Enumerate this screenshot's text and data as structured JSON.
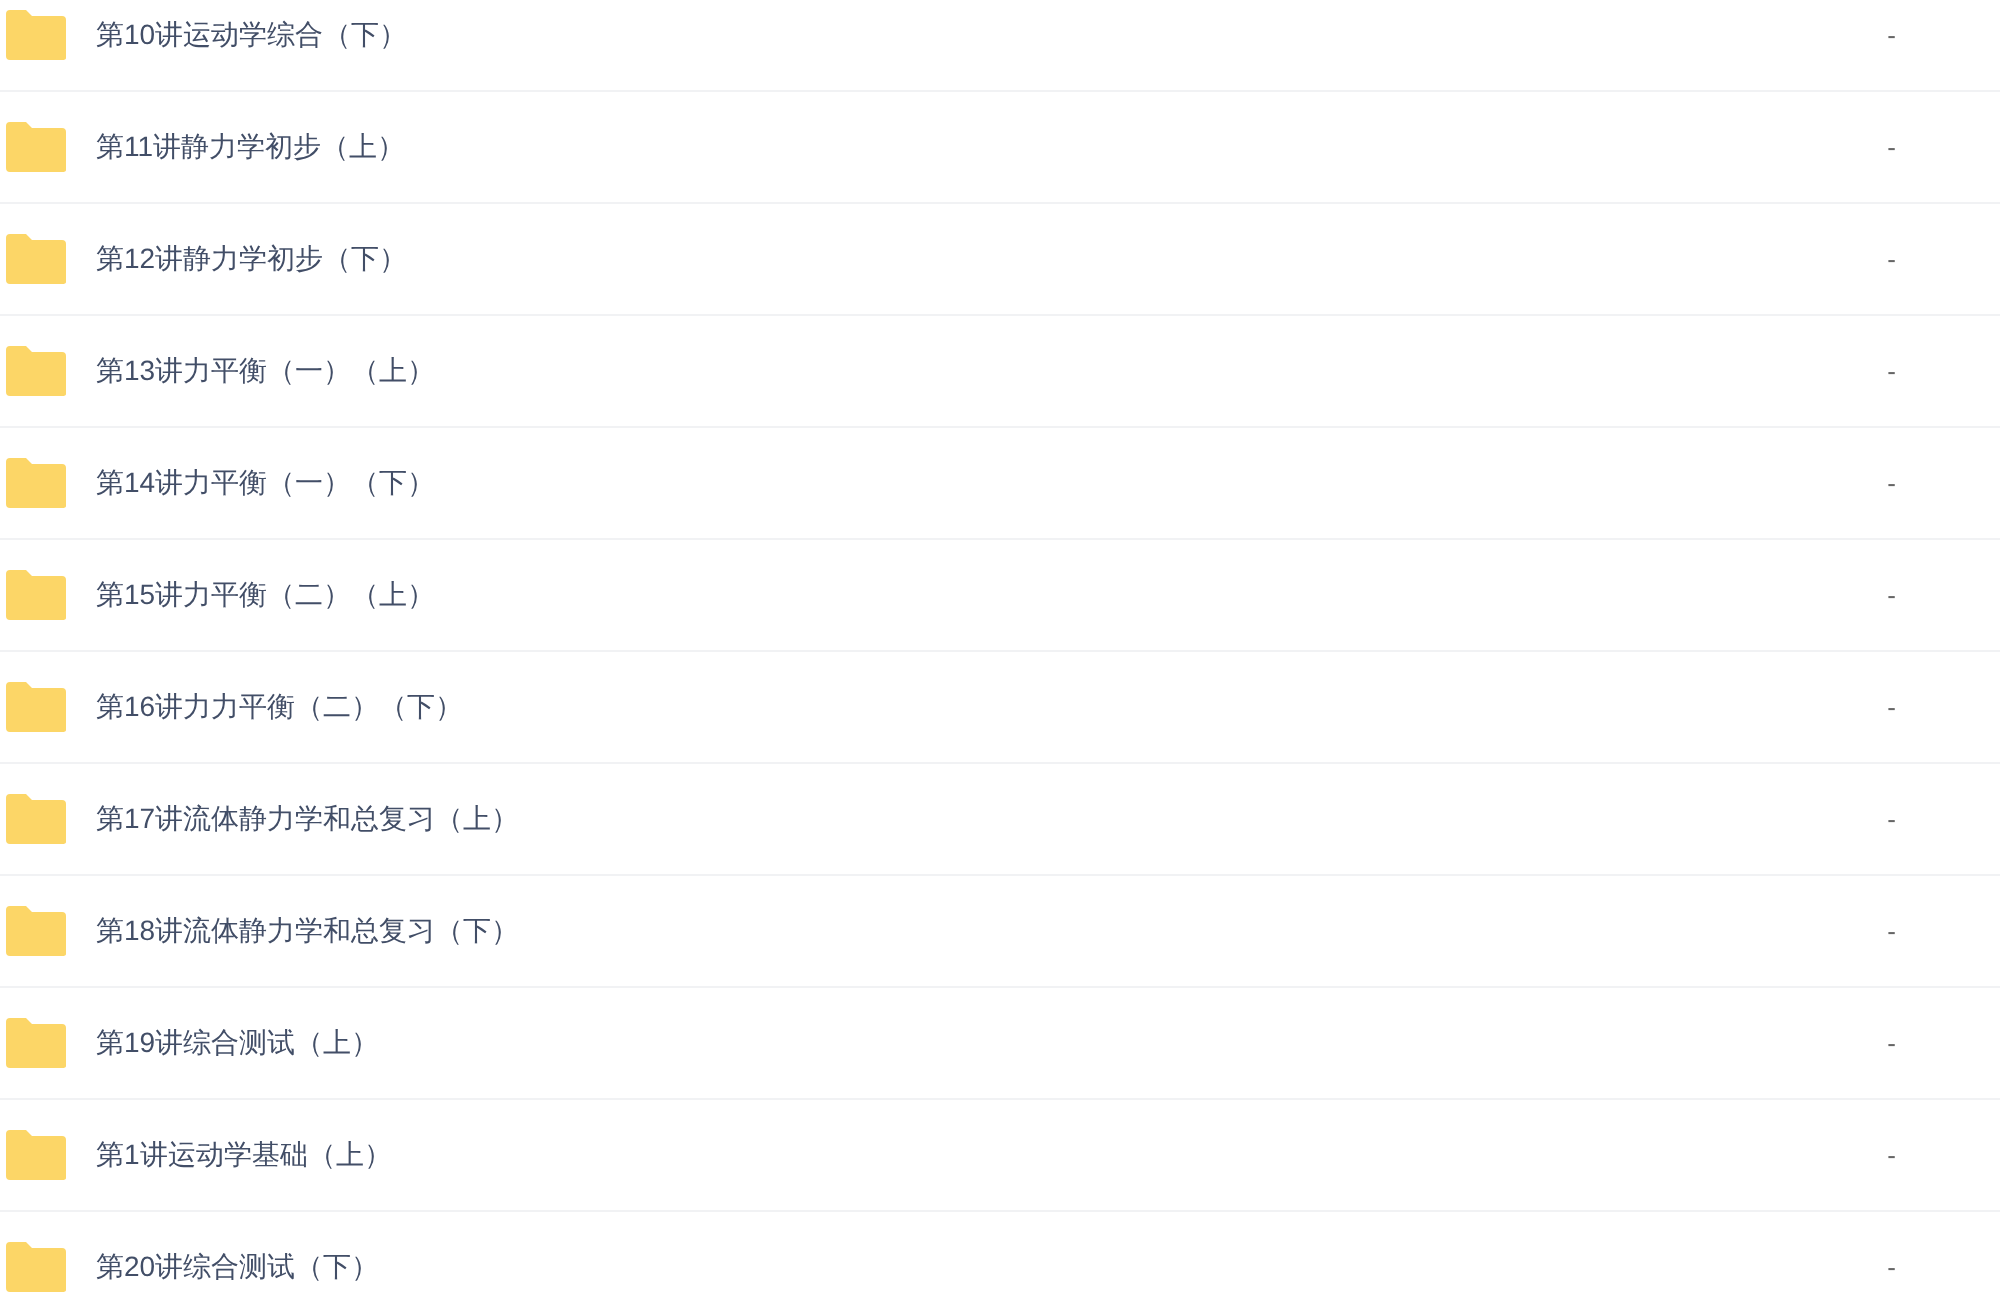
{
  "files": [
    {
      "name": "第10讲运动学综合（下）",
      "size": "-"
    },
    {
      "name": "第11讲静力学初步（上）",
      "size": "-"
    },
    {
      "name": "第12讲静力学初步（下）",
      "size": "-"
    },
    {
      "name": "第13讲力平衡（一）（上）",
      "size": "-"
    },
    {
      "name": "第14讲力平衡（一）（下）",
      "size": "-"
    },
    {
      "name": "第15讲力平衡（二）（上）",
      "size": "-"
    },
    {
      "name": "第16讲力力平衡（二）（下）",
      "size": "-"
    },
    {
      "name": "第17讲流体静力学和总复习（上）",
      "size": "-"
    },
    {
      "name": "第18讲流体静力学和总复习（下）",
      "size": "-"
    },
    {
      "name": "第19讲综合测试（上）",
      "size": "-"
    },
    {
      "name": "第1讲运动学基础（上）",
      "size": "-"
    },
    {
      "name": "第20讲综合测试（下）",
      "size": "-"
    }
  ]
}
